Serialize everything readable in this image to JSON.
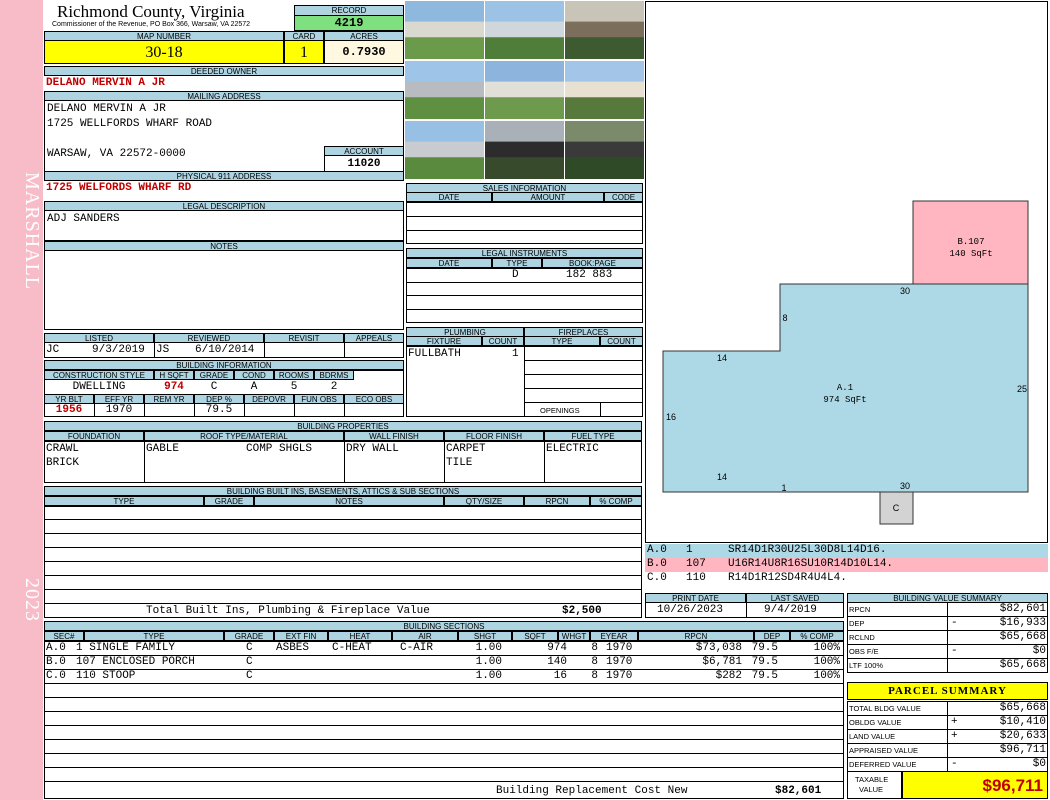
{
  "sidebar": {
    "label_top": "MARSHALL",
    "label_bottom": "2023"
  },
  "header": {
    "county": "Richmond County, Virginia",
    "commissioner": "Commissioner of the Revenue, PO Box 366, Warsaw, VA 22572",
    "record_label": "RECORD",
    "record": "4219",
    "map_label": "MAP NUMBER",
    "map_number": "30-18",
    "card_label": "CARD",
    "card": "1",
    "acres_label": "ACRES",
    "acres": "0.7930"
  },
  "owner": {
    "deeded_label": "DEEDED OWNER",
    "deeded": "DELANO MERVIN A JR",
    "mailing_label": "MAILING ADDRESS",
    "mail1": "DELANO MERVIN A JR",
    "mail2": "1725 WELLFORDS WHARF ROAD",
    "mail3": "WARSAW, VA 22572-0000",
    "account_label": "ACCOUNT",
    "account": "11020",
    "addr911_label": "PHYSICAL 911 ADDRESS",
    "addr911": "1725 WELFORDS WHARF RD"
  },
  "legal": {
    "label": "LEGAL DESCRIPTION",
    "text": "ADJ SANDERS",
    "notes_label": "NOTES"
  },
  "review": {
    "listed_label": "LISTED",
    "reviewed_label": "REVIEWED",
    "revisit_label": "REVISIT",
    "appeals_label": "APPEALS",
    "listed_by": "JC",
    "listed_date": "9/3/2019",
    "reviewed_by": "JS",
    "reviewed_date": "6/10/2014"
  },
  "building_info": {
    "label": "BUILDING INFORMATION",
    "h": [
      "CONSTRUCTION STYLE",
      "H SQFT",
      "GRADE",
      "COND",
      "ROOMS",
      "BDRMS"
    ],
    "v": [
      "DWELLING",
      "974",
      "C",
      "A",
      "5",
      "2"
    ],
    "h2": [
      "YR BLT",
      "EFF YR",
      "REM YR",
      "DEP %",
      "DEPOVR",
      "FUN OBS",
      "ECO OBS"
    ],
    "v2": [
      "1956",
      "1970",
      "",
      "79.5",
      "",
      "",
      ""
    ]
  },
  "sales": {
    "label": "SALES INFORMATION",
    "h": [
      "DATE",
      "AMOUNT",
      "CODE"
    ]
  },
  "instruments": {
    "label": "LEGAL INSTRUMENTS",
    "h": [
      "DATE",
      "TYPE",
      "BOOK:PAGE"
    ],
    "type": "D",
    "bookpage": "182 883"
  },
  "plumbing": {
    "label": "PLUMBING",
    "h": [
      "FIXTURE",
      "COUNT"
    ],
    "fixture": "FULLBATH",
    "count": "1"
  },
  "fireplaces": {
    "label": "FIREPLACES",
    "h": [
      "TYPE",
      "COUNT"
    ],
    "openings": "OPENINGS"
  },
  "properties": {
    "label": "BUILDING PROPERTIES",
    "h": [
      "FOUNDATION",
      "ROOF TYPE/MATERIAL",
      "WALL FINISH",
      "FLOOR FINISH",
      "FUEL TYPE"
    ],
    "foundation1": "CRAWL",
    "foundation2": "BRICK",
    "roof_type": "GABLE",
    "roof_mat": "COMP SHGLS",
    "wall": "DRY WALL",
    "floor1": "CARPET",
    "floor2": "TILE",
    "fuel": "ELECTRIC"
  },
  "builtins": {
    "label": "BUILDING BUILT INS, BASEMENTS, ATTICS & SUB SECTIONS",
    "h": [
      "TYPE",
      "GRADE",
      "NOTES",
      "QTY/SIZE",
      "RPCN",
      "% COMP"
    ],
    "total_label": "Total Built Ins, Plumbing & Fireplace Value",
    "total": "$2,500"
  },
  "sections": {
    "label": "BUILDING SECTIONS",
    "h": [
      "SEC#",
      "TYPE",
      "GRADE",
      "EXT FIN",
      "HEAT",
      "AIR",
      "SHGT",
      "SQFT",
      "WHGT",
      "EYEAR",
      "RPCN",
      "DEP",
      "% COMP"
    ],
    "rows": [
      [
        "A.0",
        "1 SINGLE FAMILY",
        "C",
        "ASBES",
        "C-HEAT",
        "C-AIR",
        "1.00",
        "974",
        "8",
        "1970",
        "$73,038",
        "79.5",
        "100%"
      ],
      [
        "B.0",
        "107 ENCLOSED PORCH",
        "C",
        "",
        "",
        "",
        "1.00",
        "140",
        "8",
        "1970",
        "$6,781",
        "79.5",
        "100%"
      ],
      [
        "C.0",
        "110 STOOP",
        "C",
        "",
        "",
        "",
        "1.00",
        "16",
        "8",
        "1970",
        "$282",
        "79.5",
        "100%"
      ]
    ],
    "repl_label": "Building Replacement Cost New",
    "repl": "$82,601"
  },
  "sketch": {
    "b_label": "B.107",
    "b_area": "140 SqFt",
    "a_label": "A.1",
    "a_area": "974 SqFt",
    "c_label": "C",
    "dims": [
      "30",
      "8",
      "14",
      "25",
      "16",
      "14",
      "1",
      "30"
    ]
  },
  "vectors": [
    [
      "A.0",
      "1",
      "SR14D1R30U25L30D8L14D16."
    ],
    [
      "B.0",
      "107",
      "U16R14U8R16SU10R14D10L14."
    ],
    [
      "C.0",
      "110",
      "R14D1R12SD4R4U4L4."
    ]
  ],
  "dates": {
    "print_label": "PRINT DATE",
    "print": "10/26/2023",
    "saved_label": "LAST SAVED",
    "saved": "9/4/2019"
  },
  "summary": {
    "label": "BUILDING VALUE SUMMARY",
    "rows": [
      [
        "RPCN",
        "",
        "$82,601"
      ],
      [
        "DEP",
        "-",
        "$16,933"
      ],
      [
        "RCLND",
        "",
        "$65,668"
      ],
      [
        "OBS F/E",
        "-",
        "$0"
      ],
      [
        "LTF 100%",
        "",
        "$65,668"
      ]
    ]
  },
  "parcel": {
    "label": "PARCEL SUMMARY",
    "rows": [
      [
        "TOTAL BLDG VALUE",
        "",
        "$65,668"
      ],
      [
        "OBLDG VALUE",
        "+",
        "$10,410"
      ],
      [
        "LAND VALUE",
        "+",
        "$20,633"
      ],
      [
        "APPRAISED VALUE",
        "",
        "$96,711"
      ],
      [
        "DEFERRED VALUE",
        "-",
        "$0"
      ]
    ],
    "taxable_label1": "TAXABLE",
    "taxable_label2": "VALUE",
    "taxable": "$96,711"
  },
  "colors": {
    "header": "#aed4e2",
    "sidebar": "#f7bcc8",
    "sketch_a": "#add8e6",
    "sketch_b": "#ffb6c1"
  }
}
